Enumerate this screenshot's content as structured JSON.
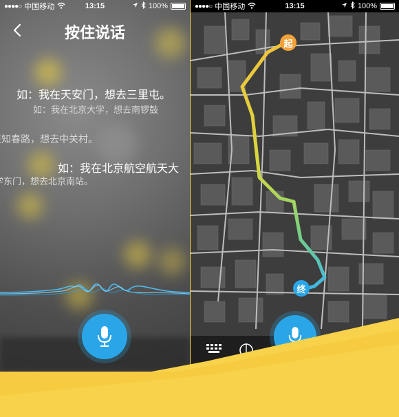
{
  "status_bar": {
    "signal": "●●●●○",
    "carrier": "中国移动",
    "time": "13:15",
    "battery": "100%"
  },
  "voice_screen": {
    "title": "按住说话",
    "hints": [
      "如：我在天安门，想去三里屯。",
      "如：我在北京大学，想去南锣鼓",
      "在知春路，想去中关村。",
      "如：我在北京航空航天大",
      "学东门，想去北京南站。"
    ]
  },
  "map_screen": {
    "start_marker": "起",
    "end_marker": "终"
  },
  "colors": {
    "accent": "#2aa6e8",
    "route_start": "#f2c33a",
    "route_end": "#3fb6e6",
    "banner": "#f7d24a"
  },
  "icons": [
    "back-icon",
    "microphone-icon",
    "keyboard-icon",
    "compass-icon",
    "location-arrow-icon",
    "bluetooth-icon",
    "battery-icon",
    "wifi-icon"
  ]
}
